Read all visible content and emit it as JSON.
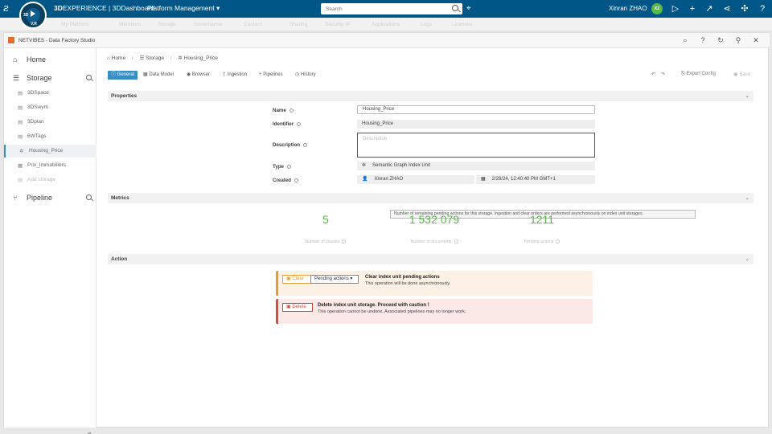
{
  "topbar": {
    "brand_bold": "3D",
    "brand_rest": "EXPERIENCE | 3DDashboard",
    "platform": "Platform Management",
    "search_placeholder": "Search",
    "username": "Xinran ZHAO",
    "avatar_initials": "XZ",
    "compass_labels": [
      "3D",
      "V,R"
    ]
  },
  "tabbar": {
    "tabs": [
      "My Platform",
      "Members",
      "Storage",
      "Governance",
      "Content",
      "Sharing",
      "Security IP",
      "Applications",
      "Logs",
      "Licenses"
    ]
  },
  "app": {
    "title": "NETVIBES - Data Factory Studio"
  },
  "sidebar": {
    "home": "Home",
    "storage": "Storage",
    "pipeline": "Pipeline",
    "items": [
      {
        "label": "3DSpace",
        "icon": "storage-icon"
      },
      {
        "label": "3DSwym",
        "icon": "storage-icon"
      },
      {
        "label": "3Dplan",
        "icon": "storage-icon"
      },
      {
        "label": "6WTags",
        "icon": "storage-icon"
      },
      {
        "label": "Housing_Price",
        "icon": "graph-icon"
      },
      {
        "label": "Prix_Immobiliers",
        "icon": "index-icon"
      },
      {
        "label": "Add storage",
        "icon": "add-icon"
      }
    ],
    "collapse": "«"
  },
  "breadcrumb": {
    "home": "Home",
    "storage": "Storage",
    "current": "Housing_Price"
  },
  "subtabs": [
    "General",
    "Data Model",
    "Browser",
    "Ingestion",
    "Pipelines",
    "History"
  ],
  "toolbar": {
    "export": "Export Config",
    "save": "Save"
  },
  "sections": {
    "properties": "Properties",
    "metrics": "Metrics",
    "action": "Action"
  },
  "properties": {
    "name_label": "Name",
    "name_value": "Housing_Price",
    "identifier_label": "Identifier",
    "identifier_value": "Housing_Price",
    "description_label": "Description",
    "description_placeholder": "Description",
    "type_label": "Type",
    "type_value": "Semantic Graph Index Unit",
    "created_label": "Created",
    "created_by": "Xinran ZHAO",
    "created_date": "2/28/24, 12:40:40 PM GMT+1"
  },
  "tooltip": "Number of remaining pending actions for this storage. Ingestion and clear orders are performed asynchronously on index unit storages.",
  "metrics": [
    {
      "value": "5",
      "label": "Number of classes"
    },
    {
      "value": "1 532 079",
      "label": "Number of documents"
    },
    {
      "value": "1211",
      "label": "Pending actions"
    }
  ],
  "actions": {
    "clear_button": "Clear",
    "pending_select": "Pending actions",
    "clear_title": "Clear index unit pending actions",
    "clear_desc": "This operation will be done asynchronously.",
    "delete_button": "Delete",
    "delete_title": "Delete index unit storage. Proceed with caution !",
    "delete_desc": "This operation cannot be undone. Associated pipelines may no longer work."
  },
  "colors": {
    "topbar": "#005686",
    "accent": "#368ec4",
    "metric_green": "#57b847",
    "warning_orange": "#e89a2b",
    "danger_red": "#d64c3f"
  }
}
